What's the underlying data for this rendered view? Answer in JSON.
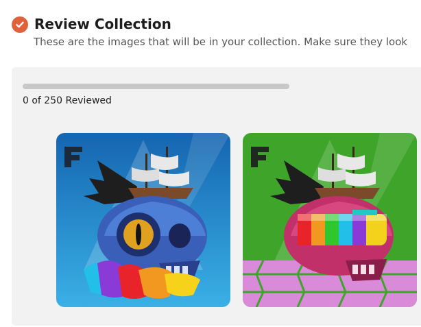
{
  "header": {
    "title": "Review Collection",
    "subtitle": "These are the images that will be in your collection. Make sure they look"
  },
  "review": {
    "progress_label": "0 of 250 Reviewed",
    "reviewed": 0,
    "total": 250,
    "progress_fraction": 0
  },
  "gallery": {
    "items": [
      {
        "background": "#2a8fd4",
        "skull_color": "#3a5fb8",
        "accent": "eye"
      },
      {
        "background": "#3fa52a",
        "skull_color": "#c2306a",
        "accent": "visor"
      }
    ]
  },
  "colors": {
    "accent": "#e0623a",
    "panel": "#f2f2f2",
    "track": "#c8c8c8"
  },
  "icons": {
    "status": "check-circle-icon",
    "watermark": "f-logo-icon"
  }
}
